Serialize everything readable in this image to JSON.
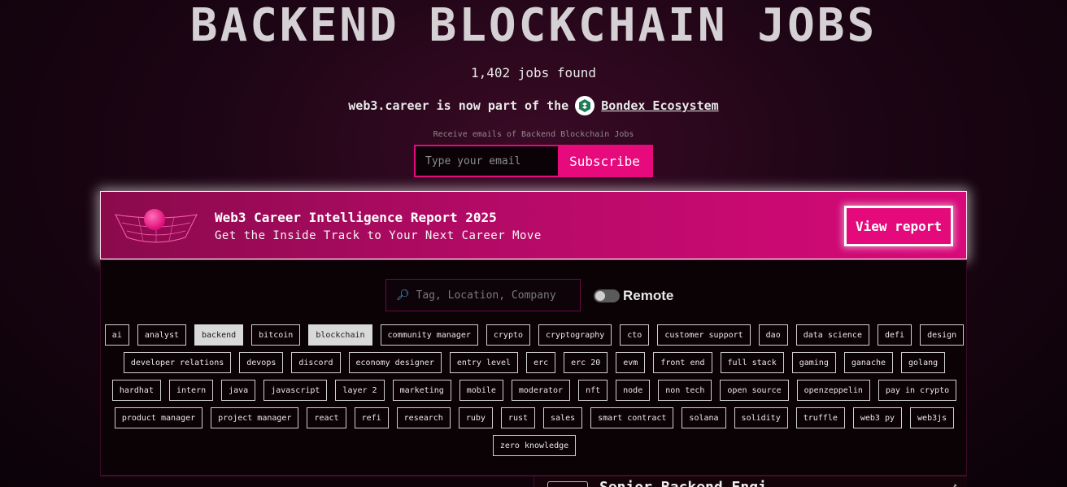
{
  "header": {
    "title": "BACKEND BLOCKCHAIN JOBS",
    "jobs_count": "1,402 jobs found",
    "bondex_prefix": "web3.career is now part of the",
    "bondex_link": "Bondex Ecosystem"
  },
  "subscribe": {
    "caption": "Receive emails of Backend Blockchain Jobs",
    "email_placeholder": "Type your email",
    "button_label": "Subscribe"
  },
  "banner": {
    "title": "Web3 Career Intelligence Report 2025",
    "subtitle": "Get the Inside Track to Your Next Career Move",
    "button_label": "View report"
  },
  "filters": {
    "search_placeholder": "Tag, Location, Company",
    "remote_label": "Remote",
    "remote_on": false
  },
  "tags": [
    {
      "label": "ai",
      "active": false
    },
    {
      "label": "analyst",
      "active": false
    },
    {
      "label": "backend",
      "active": true
    },
    {
      "label": "bitcoin",
      "active": false
    },
    {
      "label": "blockchain",
      "active": true
    },
    {
      "label": "community manager",
      "active": false
    },
    {
      "label": "crypto",
      "active": false
    },
    {
      "label": "cryptography",
      "active": false
    },
    {
      "label": "cto",
      "active": false
    },
    {
      "label": "customer support",
      "active": false
    },
    {
      "label": "dao",
      "active": false
    },
    {
      "label": "data science",
      "active": false
    },
    {
      "label": "defi",
      "active": false
    },
    {
      "label": "design",
      "active": false
    },
    {
      "label": "developer relations",
      "active": false
    },
    {
      "label": "devops",
      "active": false
    },
    {
      "label": "discord",
      "active": false
    },
    {
      "label": "economy designer",
      "active": false
    },
    {
      "label": "entry level",
      "active": false
    },
    {
      "label": "erc",
      "active": false
    },
    {
      "label": "erc 20",
      "active": false
    },
    {
      "label": "evm",
      "active": false
    },
    {
      "label": "front end",
      "active": false
    },
    {
      "label": "full stack",
      "active": false
    },
    {
      "label": "gaming",
      "active": false
    },
    {
      "label": "ganache",
      "active": false
    },
    {
      "label": "golang",
      "active": false
    },
    {
      "label": "hardhat",
      "active": false
    },
    {
      "label": "intern",
      "active": false
    },
    {
      "label": "java",
      "active": false
    },
    {
      "label": "javascript",
      "active": false
    },
    {
      "label": "layer 2",
      "active": false
    },
    {
      "label": "marketing",
      "active": false
    },
    {
      "label": "mobile",
      "active": false
    },
    {
      "label": "moderator",
      "active": false
    },
    {
      "label": "nft",
      "active": false
    },
    {
      "label": "node",
      "active": false
    },
    {
      "label": "non tech",
      "active": false
    },
    {
      "label": "open source",
      "active": false
    },
    {
      "label": "openzeppelin",
      "active": false
    },
    {
      "label": "pay in crypto",
      "active": false
    },
    {
      "label": "product manager",
      "active": false
    },
    {
      "label": "project manager",
      "active": false
    },
    {
      "label": "react",
      "active": false
    },
    {
      "label": "refi",
      "active": false
    },
    {
      "label": "research",
      "active": false
    },
    {
      "label": "ruby",
      "active": false
    },
    {
      "label": "rust",
      "active": false
    },
    {
      "label": "sales",
      "active": false
    },
    {
      "label": "smart contract",
      "active": false
    },
    {
      "label": "solana",
      "active": false
    },
    {
      "label": "solidity",
      "active": false
    },
    {
      "label": "truffle",
      "active": false
    },
    {
      "label": "web3 py",
      "active": false
    },
    {
      "label": "web3js",
      "active": false
    },
    {
      "label": "zero knowledge",
      "active": false
    }
  ],
  "job_preview": {
    "title": "Senior Backend Engi"
  },
  "colors": {
    "accent": "#e60a7d",
    "background": "#1c0514"
  }
}
